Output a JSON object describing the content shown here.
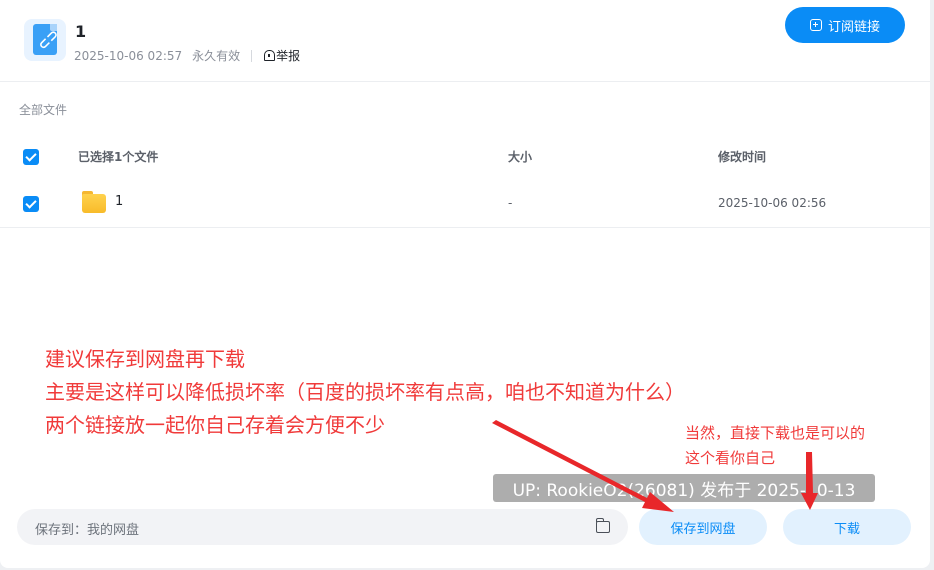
{
  "header": {
    "title": "1",
    "date": "2025-10-06 02:57",
    "validity": "永久有效",
    "report_label": "举报",
    "subscribe_label": "订阅链接"
  },
  "breadcrumb": "全部文件",
  "table": {
    "selection_label": "已选择1个文件",
    "columns": {
      "size": "大小",
      "modified": "修改时间"
    },
    "rows": [
      {
        "name": "1",
        "size": "-",
        "modified": "2025-10-06 02:56",
        "checked": true
      }
    ]
  },
  "annotations": {
    "main_lines": [
      "建议保存到网盘再下载",
      "主要是这样可以降低损坏率（百度的损坏率有点高，咱也不知道为什么）",
      "两个链接放一起你自己存着会方便不少"
    ],
    "side_lines": [
      "当然，直接下载也是可以的",
      "这个看你自己"
    ],
    "watermark": "UP: RookieO2(26081) 发布于 2025-10-13"
  },
  "footer": {
    "save_to_label": "保存到：我的网盘",
    "save_button": "保存到网盘",
    "download_button": "下载"
  },
  "colors": {
    "accent": "#0a8cf6",
    "annotation": "#f03a3a",
    "folder": "#f8bb2a"
  }
}
